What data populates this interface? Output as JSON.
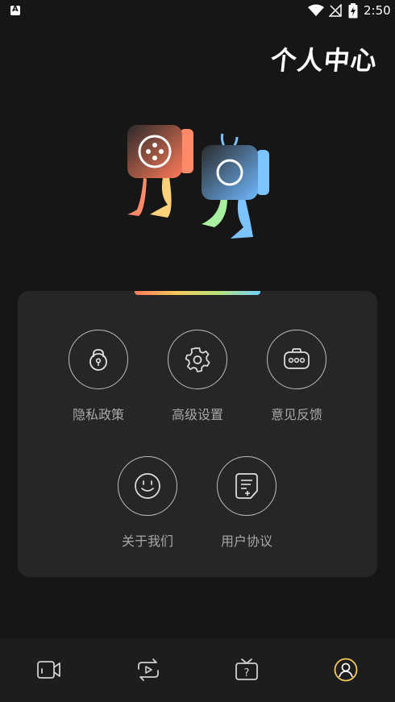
{
  "status_bar": {
    "time": "2:50",
    "icons": [
      "app-notification-icon",
      "wifi-icon",
      "no-signal-icon",
      "battery-charging-icon"
    ]
  },
  "page": {
    "title": "个人中心"
  },
  "menu": {
    "items": [
      {
        "label": "隐私政策",
        "icon": "lock-icon"
      },
      {
        "label": "高级设置",
        "icon": "gear-icon"
      },
      {
        "label": "意见反馈",
        "icon": "chat-bubble-icon"
      },
      {
        "label": "关于我们",
        "icon": "smiley-icon"
      },
      {
        "label": "用户协议",
        "icon": "document-icon"
      }
    ]
  },
  "bottom_nav": {
    "tabs": [
      {
        "icon": "video-camera-icon",
        "selected": false
      },
      {
        "icon": "repeat-play-icon",
        "selected": false
      },
      {
        "icon": "tv-question-icon",
        "selected": false
      },
      {
        "icon": "user-profile-icon",
        "selected": true
      }
    ]
  },
  "colors": {
    "background": "#161616",
    "card": "#262626",
    "nav_background": "#1d1d1d",
    "selected_tab": "#f4c95d",
    "rainbow": [
      "#ff7a59",
      "#f4c95d",
      "#b9e37b",
      "#6fd1ff"
    ]
  }
}
